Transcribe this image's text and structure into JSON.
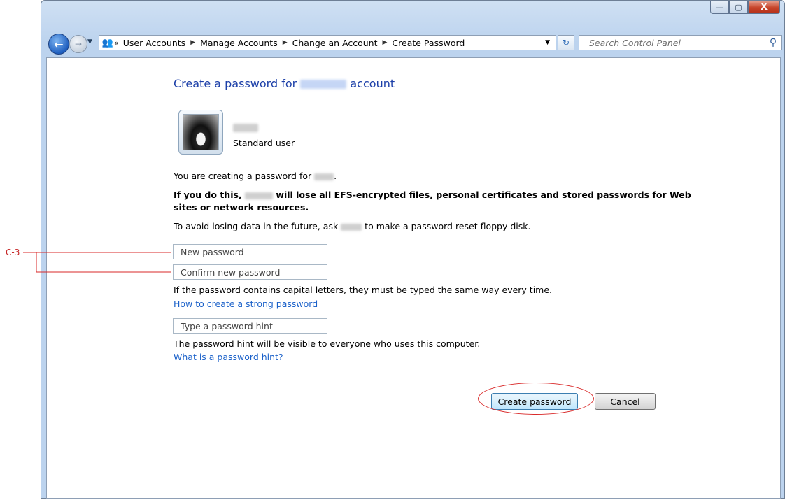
{
  "window": {
    "controls": {
      "minimize": "—",
      "maximize": "▢",
      "close": "X"
    }
  },
  "nav": {
    "back_icon": "back-arrow-icon",
    "forward_icon": "forward-arrow-icon",
    "breadcrumb": [
      "User Accounts",
      "Manage Accounts",
      "Change an Account",
      "Create Password"
    ],
    "breadcrumb_prefix": "«",
    "search_placeholder": "Search Control Panel"
  },
  "page": {
    "title_prefix": "Create a password for",
    "title_suffix": "account",
    "user_type": "Standard user",
    "creating_text": "You are creating a password for",
    "warning_prefix": "If you do this,",
    "warning_line1": "will lose all EFS-encrypted files, personal certificates and stored passwords for Web",
    "warning_line2": "sites or network resources.",
    "avoid_prefix": "To avoid losing data in the future, ask",
    "avoid_suffix": "to make a password reset floppy disk.",
    "new_password_placeholder": "New password",
    "confirm_password_placeholder": "Confirm new password",
    "caps_note": "If the password contains capital letters, they must be typed the same way every time.",
    "strong_password_link": "How to create a strong password",
    "hint_placeholder": "Type a password hint",
    "hint_note": "The password hint will be visible to everyone who uses this computer.",
    "hint_link": "What is a password hint?",
    "create_button": "Create password",
    "cancel_button": "Cancel"
  },
  "annotation": {
    "label": "C-3",
    "color": "#d92a2a"
  },
  "colors": {
    "title": "#1c3fa8",
    "link": "#1b61c9",
    "redaction": "#c5d6f5"
  }
}
